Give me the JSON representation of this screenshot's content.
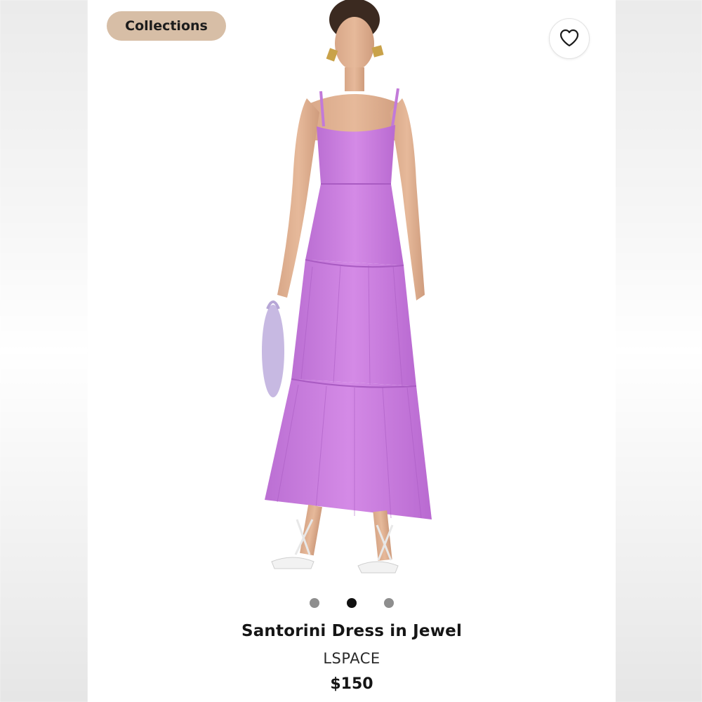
{
  "header": {
    "collections_label": "Collections",
    "collections_color": "#d7bea6",
    "favorite_icon": "heart-icon"
  },
  "gallery": {
    "image_subject": "model wearing purple tiered maxi dress",
    "dress_color": "#c97fe0",
    "total_images": 3,
    "active_index": 1
  },
  "product": {
    "title": "Santorini Dress in Jewel",
    "brand": "LSPACE",
    "price": "$150"
  }
}
